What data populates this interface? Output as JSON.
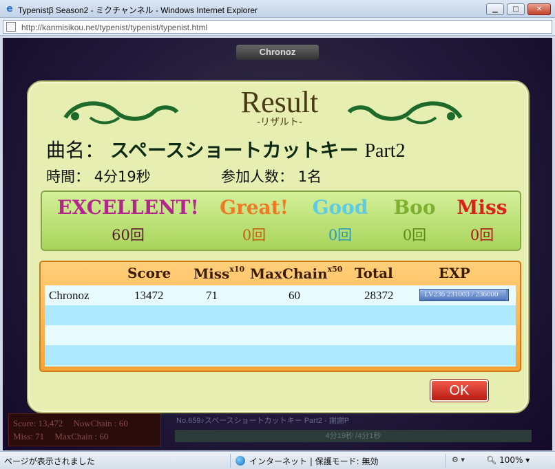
{
  "window": {
    "title": "Typenistβ Season2 - ミクチャンネル - Windows Internet Explorer",
    "url": "http://kanmisikou.net/typenist/typenist/typenist.html",
    "buttons": {
      "minimize": "▁",
      "maximize": "□",
      "close": "✕"
    }
  },
  "game": {
    "player_chip": "Chronoz",
    "footer": {
      "score": "Score: 13,472",
      "now_chain": "NowChain : 60",
      "miss": "Miss: 71",
      "max_chain": "MaxChain : 60",
      "song": "No.659♪スペースショートカットキー Part2 - 謝謝P",
      "progress_text": "4分19秒 /4分1秒"
    }
  },
  "result": {
    "title": "Result",
    "subtitle": "-リザルト-",
    "song_label": "曲名：",
    "song_name": "スペースショートカットキー",
    "song_part": "Part2",
    "time_label": "時間：",
    "time_value": "4分19秒",
    "players_label": "参加人数：",
    "players_value": "1名",
    "judgments": [
      {
        "label": "EXCELLENT!",
        "count": "60回",
        "color": "#b2268e"
      },
      {
        "label": "Great!",
        "count": "0回",
        "color": "#f07a24"
      },
      {
        "label": "Good",
        "count": "0回",
        "color": "#5ccbe6"
      },
      {
        "label": "Boo",
        "count": "0回",
        "color": "#7cb02e"
      },
      {
        "label": "Miss",
        "count": "0回",
        "color": "#d8221a"
      }
    ],
    "table": {
      "headers": {
        "score": "Score",
        "miss": "Miss",
        "miss_mult": "x10",
        "maxchain": "MaxChain",
        "maxchain_mult": "x50",
        "total": "Total",
        "exp": "EXP"
      },
      "rows": [
        {
          "name": "Chronoz",
          "score": "13472",
          "miss": "71",
          "maxchain": "60",
          "total": "28372",
          "exp_text": "LV236  231003 / 236000",
          "exp_fill": 0.979
        }
      ]
    },
    "ok_label": "OK"
  },
  "statusbar": {
    "message": "ページが表示されました",
    "zone": "インターネット | 保護モード: 無効",
    "zoom": "100%"
  }
}
